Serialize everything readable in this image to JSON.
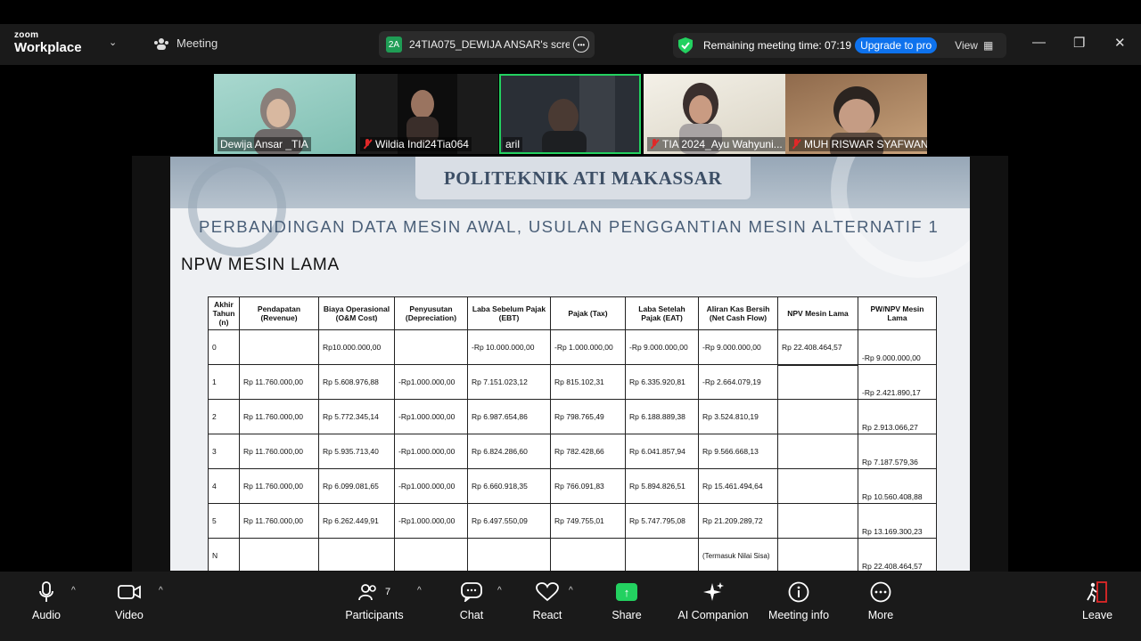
{
  "app": {
    "logo_small": "zoom",
    "logo_big": "Workplace"
  },
  "topbar": {
    "meeting_label": "Meeting",
    "share_badge": "2A",
    "share_title": "24TIA075_DEWIJA ANSAR's scree",
    "remaining_text": "Remaining meeting time: 07:19",
    "upgrade_label": "Upgrade to pro",
    "view_label": "View"
  },
  "participants_strip": [
    {
      "name": "Dewija Ansar _TIA",
      "muted": false
    },
    {
      "name": "Wildia Indi24Tia064",
      "muted": true
    },
    {
      "name": "aril",
      "muted": false
    },
    {
      "name": "TIA 2024_Ayu Wahyuni...",
      "muted": true
    },
    {
      "name": "MUH RISWAR SYAFWAN",
      "muted": true
    }
  ],
  "slide": {
    "institution": "POLITEKNIK ATI MAKASSAR",
    "subtitle": "PERBANDINGAN DATA MESIN AWAL, USULAN PENGGANTIAN MESIN ALTERNATIF 1",
    "heading": "NPW MESIN LAMA",
    "table": {
      "headers": [
        "Akhir Tahun (n)",
        "Pendapatan (Revenue)",
        "Biaya Operasional (O&M Cost)",
        "Penyusutan (Depreciation)",
        "Laba Sebelum Pajak (EBT)",
        "Pajak (Tax)",
        "Laba Setelah Pajak (EAT)",
        "Aliran Kas Bersih (Net Cash Flow)",
        "NPV Mesin Lama",
        "PW/NPV Mesin Lama"
      ],
      "rows": [
        [
          "0",
          "",
          "Rp10.000.000,00",
          "",
          "-Rp  10.000.000,00",
          "-Rp  1.000.000,00",
          "-Rp 9.000.000,00",
          "-Rp   9.000.000,00",
          "Rp  22.408.464,57",
          "-Rp     9.000.000,00"
        ],
        [
          "1",
          "Rp  11.760.000,00",
          "Rp   5.608.976,88",
          "-Rp1.000.000,00",
          "Rp      7.151.023,12",
          "Rp       815.102,31",
          "Rp 6.335.920,81",
          "-Rp   2.664.079,19",
          "",
          "-Rp     2.421.890,17"
        ],
        [
          "2",
          "Rp  11.760.000,00",
          "Rp   5.772.345,14",
          "-Rp1.000.000,00",
          "Rp      6.987.654,86",
          "Rp       798.765,49",
          "Rp 6.188.889,38",
          "Rp    3.524.810,19",
          "",
          "Rp       2.913.066,27"
        ],
        [
          "3",
          "Rp  11.760.000,00",
          "Rp   5.935.713,40",
          "-Rp1.000.000,00",
          "Rp      6.824.286,60",
          "Rp       782.428,66",
          "Rp 6.041.857,94",
          "Rp    9.566.668,13",
          "",
          "Rp       7.187.579,36"
        ],
        [
          "4",
          "Rp  11.760.000,00",
          "Rp   6.099.081,65",
          "-Rp1.000.000,00",
          "Rp      6.660.918,35",
          "Rp       766.091,83",
          "Rp 5.894.826,51",
          "Rp  15.461.494,64",
          "",
          "Rp     10.560.408,88"
        ],
        [
          "5",
          "Rp  11.760.000,00",
          "Rp   6.262.449,91",
          "-Rp1.000.000,00",
          "Rp      6.497.550,09",
          "Rp       749.755,01",
          "Rp 5.747.795,08",
          "Rp  21.209.289,72",
          "",
          "Rp     13.169.300,23"
        ],
        [
          "N",
          "",
          "",
          "",
          "",
          "",
          "",
          "(Termasuk Nilai Sisa)",
          "",
          "Rp     22.408.464,57"
        ]
      ]
    }
  },
  "toolbar": {
    "audio": "Audio",
    "video": "Video",
    "participants": "Participants",
    "participants_count": "7",
    "chat": "Chat",
    "react": "React",
    "share": "Share",
    "ai": "AI Companion",
    "info": "Meeting info",
    "more": "More",
    "leave": "Leave"
  },
  "colors": {
    "accent_blue": "#0e72ed",
    "share_green": "#23d160",
    "leave_red": "#e02828"
  }
}
